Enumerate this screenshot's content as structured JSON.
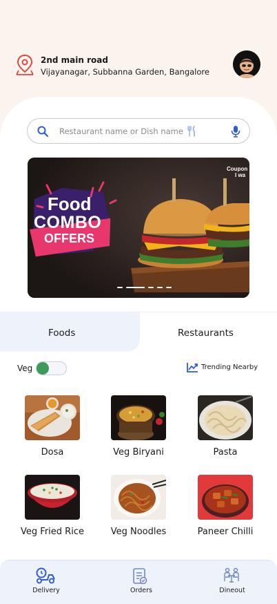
{
  "location": {
    "line1": "2nd main road",
    "line2": "Vijayanagar, Subbanna Garden, Bangalore",
    "pin_icon": "location-pin-icon",
    "pin_color": "#e0473b"
  },
  "profile": {
    "avatar_icon": "user-avatar"
  },
  "search": {
    "placeholder": "Restaurant name or Dish name",
    "search_icon": "search-icon",
    "fork_icon": "fork-knife-icon",
    "mic_icon": "microphone-icon",
    "accent": "#2f5bd3"
  },
  "banner": {
    "food_text": "Food",
    "combo_text": "COMBO",
    "offers_text": "OFFERS",
    "brand_line1": "Coupon",
    "brand_line2": "I wa",
    "slide_count": 5,
    "active_slide": 2
  },
  "tabs": [
    {
      "label": "Foods",
      "selected": true
    },
    {
      "label": "Restaurants",
      "selected": false
    }
  ],
  "filters": {
    "veg_label": "Veg",
    "veg_toggle_on": false,
    "toggle_color": "#3d9b5a",
    "trending_label": "Trending Nearby",
    "trending_icon": "trending-up-icon"
  },
  "foods": [
    {
      "name": "Dosa"
    },
    {
      "name": "Veg Biryani"
    },
    {
      "name": "Pasta"
    },
    {
      "name": "Veg Fried Rice"
    },
    {
      "name": "Veg Noodles"
    },
    {
      "name": "Paneer Chilli"
    }
  ],
  "bottom_nav": [
    {
      "label": "Delivery",
      "icon": "delivery-scooter-icon",
      "active": true
    },
    {
      "label": "Orders",
      "icon": "orders-clipboard-icon",
      "active": false
    },
    {
      "label": "Dineout",
      "icon": "dineout-table-icon",
      "active": false
    }
  ],
  "colors": {
    "header_bg": "#fbf3ee",
    "tab_active_bg": "#eef3fb",
    "nav_bg": "#eef3fb",
    "nav_icon": "#2f5bd3"
  }
}
